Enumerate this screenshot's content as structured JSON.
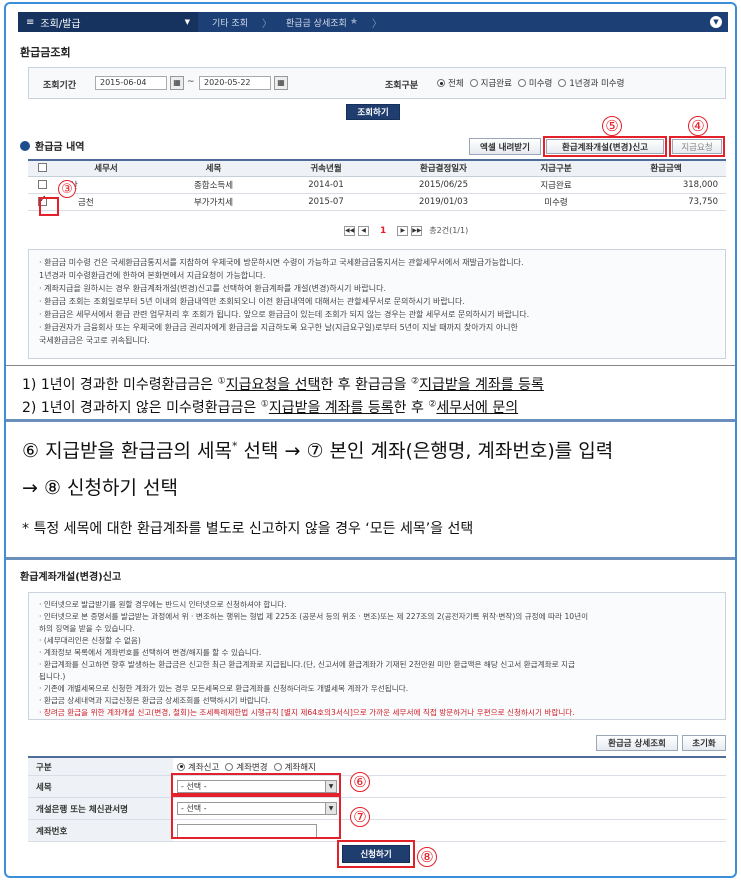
{
  "nav": {
    "menu_label": "조회/발급",
    "crumb1": "기타 조회",
    "crumb2": "환급금 상세조회"
  },
  "section1": {
    "title": "환급금조회",
    "period_label": "조회기간",
    "date_from": "2015-06-04",
    "date_to": "2020-05-22",
    "tilde": "~",
    "type_label": "조회구분",
    "radios": [
      "전체",
      "지급완료",
      "미수령",
      "1년경과 미수령"
    ],
    "search_button": "조회하기"
  },
  "list": {
    "title": "환급금 내역",
    "excel_button": "엑셀 내려받기",
    "account_button": "환급계좌개설(변경)신고",
    "request_button": "지급요청",
    "columns": [
      "세무서",
      "세목",
      "귀속년월",
      "환급결정일자",
      "지급구분",
      "환급금액"
    ],
    "rows": [
      {
        "office": "논산",
        "tax": "종합소득세",
        "period": "2014-01",
        "date": "2015/06/25",
        "status": "지급완료",
        "amount": "318,000"
      },
      {
        "office": "금천",
        "tax": "부가가치세",
        "period": "2015-07",
        "date": "2019/01/03",
        "status": "미수령",
        "amount": "73,750"
      }
    ],
    "page_current": "1",
    "page_total": "총2건(1/1)"
  },
  "notes1": [
    "· 환급금 미수령 건은 국세환급금통지서를 지참하여 우체국에 방문하시면 수령이 가능하고 국세환급금통지서는 관할세무서에서 재발급가능합니다.",
    "  1년경과 미수령환급건에 한하여 본화면에서 지급요청이 가능합니다.",
    "· 계좌지급을 원하시는 경우 환급계좌개설(변경)신고를 선택하여 환급계좌를 개설(변경)하시기 바랍니다.",
    "· 환급금 조회는 조회일로부터 5년 이내의 환급내역만 조회되오니 이전 환급내역에 대해서는 관할세무서로 문의하시기 바랍니다.",
    "· 환급금은 세무서에서 환급 관련 업무처리 후 조회가 됩니다. 앞으로 환급금이 있는데 조회가 되지 않는 경우는 관할 세무서로 문의하시기 바랍니다.",
    "· 환급권자가 금융회사 또는 우체국에 환급금 권리자에게 환급금을 지급하도록 요구한 날(지급요구일)로부터 5년이 지날 때까지 찾아가지 아니한",
    "  국세환급금은 국고로 귀속됩니다."
  ],
  "instructions": {
    "line1_a": "1) 1년이 경과한 미수령환급금은 ",
    "line1_sup1": "①",
    "line1_b": "지급요청을 선택",
    "line1_c": "한 후 환급금을 ",
    "line1_sup2": "②",
    "line1_d": "지급받을 계좌를 등록",
    "line2_a": "2) 1년이 경과하지 않은 미수령환급금은 ",
    "line2_sup1": "①",
    "line2_b": "지급받을 계좌를 등록",
    "line2_c": "한 후 ",
    "line2_sup2": "②",
    "line2_d": "세무서에 문의",
    "big1": "⑥ 지급받을 환급금의 세목",
    "big1_sup": "*",
    "big1_b": " 선택 → ⑦ 본인 계좌(은행명, 계좌번호)를 입력",
    "big2": "→ ⑧ 신청하기 선택",
    "note": "* 특정 세목에 대한 환급계좌를 별도로 신고하지 않을 경우 ‘모든 세목’을 선택"
  },
  "section2": {
    "title": "환급계좌개설(변경)신고",
    "notes": [
      "· 인터넷으로 발급받기를 원할 경우에는 반드시 인터넷으로 신청하셔야 합니다.",
      "· 인터넷으로 본 증명서를 발급받는 과정에서 위 · 변조하는 행위는 형법 제 225조 (공문서 등의 위조 · 변조)또는 제 227조의 2(공전자기록 위작·변작)의 규정에 따라 10년이",
      "  하의 징역을 받을 수 있습니다.",
      "· (세무대리인은 신청할 수 없음)",
      "· 계좌정보 목록에서 계좌번호를 선택하여 변경/해지를 할 수 있습니다.",
      "· 환급계좌를 신고하면 향후 발생하는 환급금은 신고한 최근 환급계좌로 지급됩니다.(단, 신고서에 환급계좌가 기재된 2천만원 미만 환급액은 해당 신고서 환급계좌로 지급",
      "  됩니다.)",
      "· 기존에 개별세목으로 신청한 계좌가 있는 경우 모든세목으로 환급계좌를 신청하더라도 개별세목 계좌가 우선됩니다.",
      "· 환급금 상세내역과 지급신청은 환급금 상세조회를 선택하시기 바랍니다."
    ],
    "red_note": "· 장려금 환급을 위한 계좌개설 신고(변경, 철회)는 조세특례제한법 시행규칙 [별지 제64호의3서식]으로 가까운 세무서에 직접 방문하거나 우편으로 신청하시기 바랍니다.",
    "detail_button": "환급금 상세조회",
    "reset_button": "초기화",
    "form": {
      "type_label": "구분",
      "type_options": [
        "계좌신고",
        "계좌변경",
        "계좌해지"
      ],
      "tax_label": "세목",
      "tax_value": "- 선택 -",
      "bank_label": "개설은행 또는 체신관서명",
      "bank_value": "- 선택 -",
      "account_label": "계좌번호",
      "submit_button": "신청하기"
    }
  },
  "markers": {
    "m3": "③",
    "m4": "④",
    "m5": "⑤",
    "m6": "⑥",
    "m7": "⑦",
    "m8": "⑧"
  }
}
